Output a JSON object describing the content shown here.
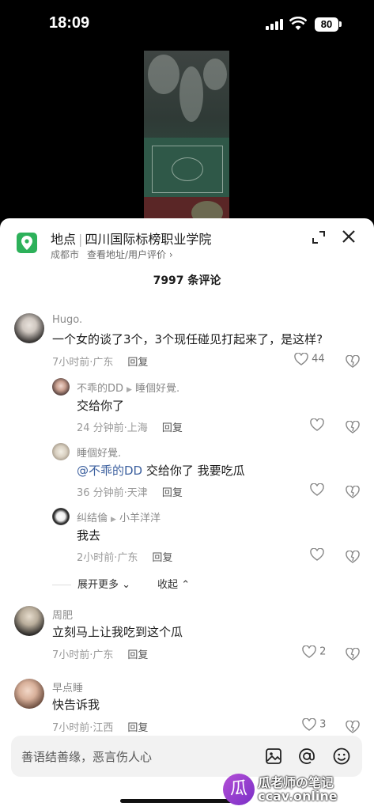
{
  "status": {
    "time": "18:09",
    "battery": "80"
  },
  "location": {
    "tag": "地点",
    "name": "四川国际标榜职业学院",
    "city": "成都市",
    "link": "查看地址/用户评价 ›"
  },
  "comment_count": "7997 条评论",
  "comments": [
    {
      "name": "Hugo.",
      "text": "一个女的谈了3个，3个现任碰见打起来了，是这样?",
      "time": "7小时前·广东",
      "reply": "回复",
      "likes": "44"
    },
    {
      "name": "不乖的DD",
      "reply_to": "睡個好覺.",
      "text": "交给你了",
      "time": "24 分钟前·上海",
      "reply": "回复",
      "likes": ""
    },
    {
      "name": "睡個好覺.",
      "mention": "@不乖的DD",
      "text": " 交给你了 我要吃瓜",
      "time": "36 分钟前·天津",
      "reply": "回复",
      "likes": ""
    },
    {
      "name": "纠结倫",
      "reply_to": "小羊洋洋",
      "text": "我去",
      "time": "2小时前·广东",
      "reply": "回复",
      "likes": ""
    },
    {
      "name": "周肥",
      "text": "立刻马上让我吃到这个瓜",
      "time": "7小时前·广东",
      "reply": "回复",
      "likes": "2"
    },
    {
      "name": "早点睡",
      "text": "快告诉我",
      "time": "7小时前·江西",
      "reply": "回复",
      "likes": "3"
    }
  ],
  "thread_controls": {
    "expand": "展开更多",
    "collapse": "收起"
  },
  "input": {
    "placeholder": "善语结善缘，恶言伤人心"
  },
  "watermark": {
    "line1": "瓜老师の笔记",
    "line2": "ccav.online"
  },
  "colors": {
    "accent_green": "#2db15a",
    "mention": "#3b5f9e"
  }
}
